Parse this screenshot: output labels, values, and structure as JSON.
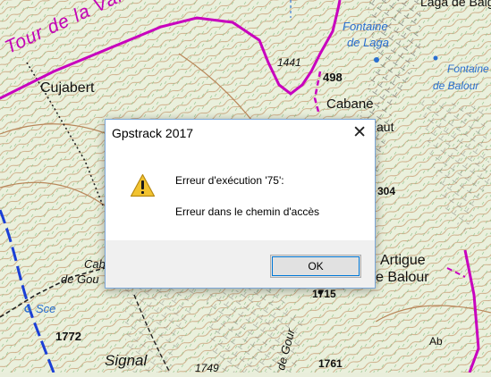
{
  "map": {
    "trail_name": "Tour de la Vallée d'Ossau",
    "labels": {
      "laga_de_baigt": "Laga de Baigt",
      "fontaine_de": "Fontaine",
      "de_laga": "de Laga",
      "fontaine_de_balour_1": "Fontaine",
      "fontaine_de_balour_2": "de Balour",
      "alt_1441": "1441",
      "alt_498": "498",
      "cujabert": "Cujabert",
      "cabane": "Cabane",
      "aut": "aut",
      "n304": "304",
      "cab": "Cab",
      "de_gou": "de Gou",
      "sce": "Sce",
      "artigue": "Artigue",
      "le_balour": "e Balour",
      "alt_1715": "1715",
      "alt_1772": "1772",
      "signal": "Signal",
      "alt_1749": "1749",
      "gour": "de Gour",
      "alt_1761": "1761",
      "ab": "Ab"
    }
  },
  "dialog": {
    "title": "Gpstrack 2017",
    "close_glyph": "✕",
    "message_line1": "Erreur d'exécution '75':",
    "message_line2": "Erreur dans le chemin d'accès",
    "ok_label": "OK",
    "icon": "warning-icon"
  }
}
